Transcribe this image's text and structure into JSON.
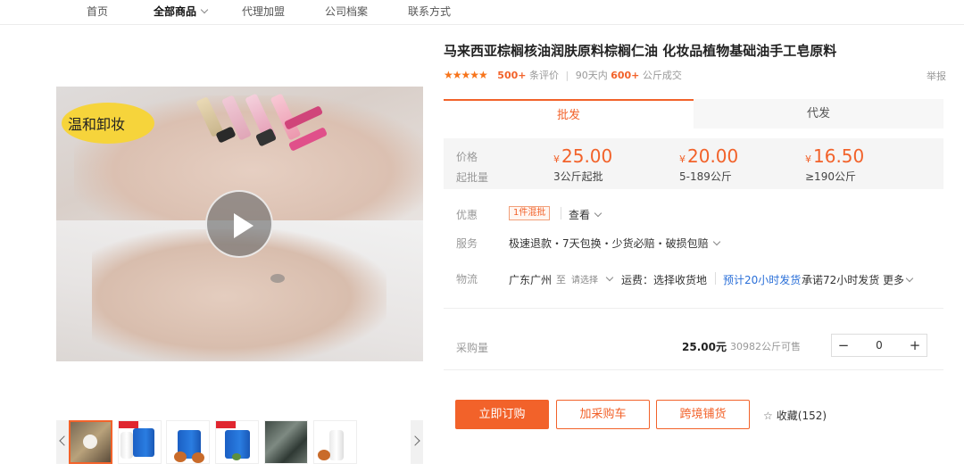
{
  "nav": {
    "items": [
      "首页",
      "全部商品",
      "代理加盟",
      "公司档案",
      "联系方式"
    ],
    "active_index": 1
  },
  "media": {
    "bubble_text": "温和卸妆",
    "thumbnail_count": 6
  },
  "product": {
    "title": "马来西亚棕榈核油润肤原料棕榈仁油 化妆品植物基础油手工皂原料",
    "stars": "★★★★★",
    "review_count": "500+",
    "review_label": "条评价",
    "sales_period": "90天内",
    "sales_count": "600+",
    "sales_unit": "公斤成交",
    "report_label": "举报"
  },
  "tabs": [
    "批发",
    "代发"
  ],
  "price_panel": {
    "price_label": "价格",
    "moq_label": "起批量",
    "currency": "¥",
    "tiers": [
      {
        "price": "25.00",
        "qty": "3公斤起批"
      },
      {
        "price": "20.00",
        "qty": "5-189公斤"
      },
      {
        "price": "16.50",
        "qty": "≥190公斤"
      }
    ]
  },
  "promo": {
    "label": "优惠",
    "badge": "1件混批",
    "view": "查看"
  },
  "service": {
    "label": "服务",
    "text": "极速退款・7天包换・少货必赔・破损包赔"
  },
  "logistics": {
    "label": "物流",
    "origin": "广东广州",
    "to": "至",
    "select": "请选择",
    "freight": "运费：选择收货地",
    "estimate": "预计20小时发货",
    "promise": "承诺72小时发货",
    "more": "更多"
  },
  "purchase": {
    "label": "采购量",
    "unit_price": "25.00元",
    "stock": "30982公斤可售",
    "quantity": "0",
    "minus": "−",
    "plus": "+"
  },
  "actions": {
    "buy_now": "立即订购",
    "add_cart": "加采购车",
    "cross_border": "跨境铺货",
    "favorite": "收藏(152)"
  },
  "colors": {
    "accent": "#f2622a",
    "bubble": "#f6d43b"
  }
}
